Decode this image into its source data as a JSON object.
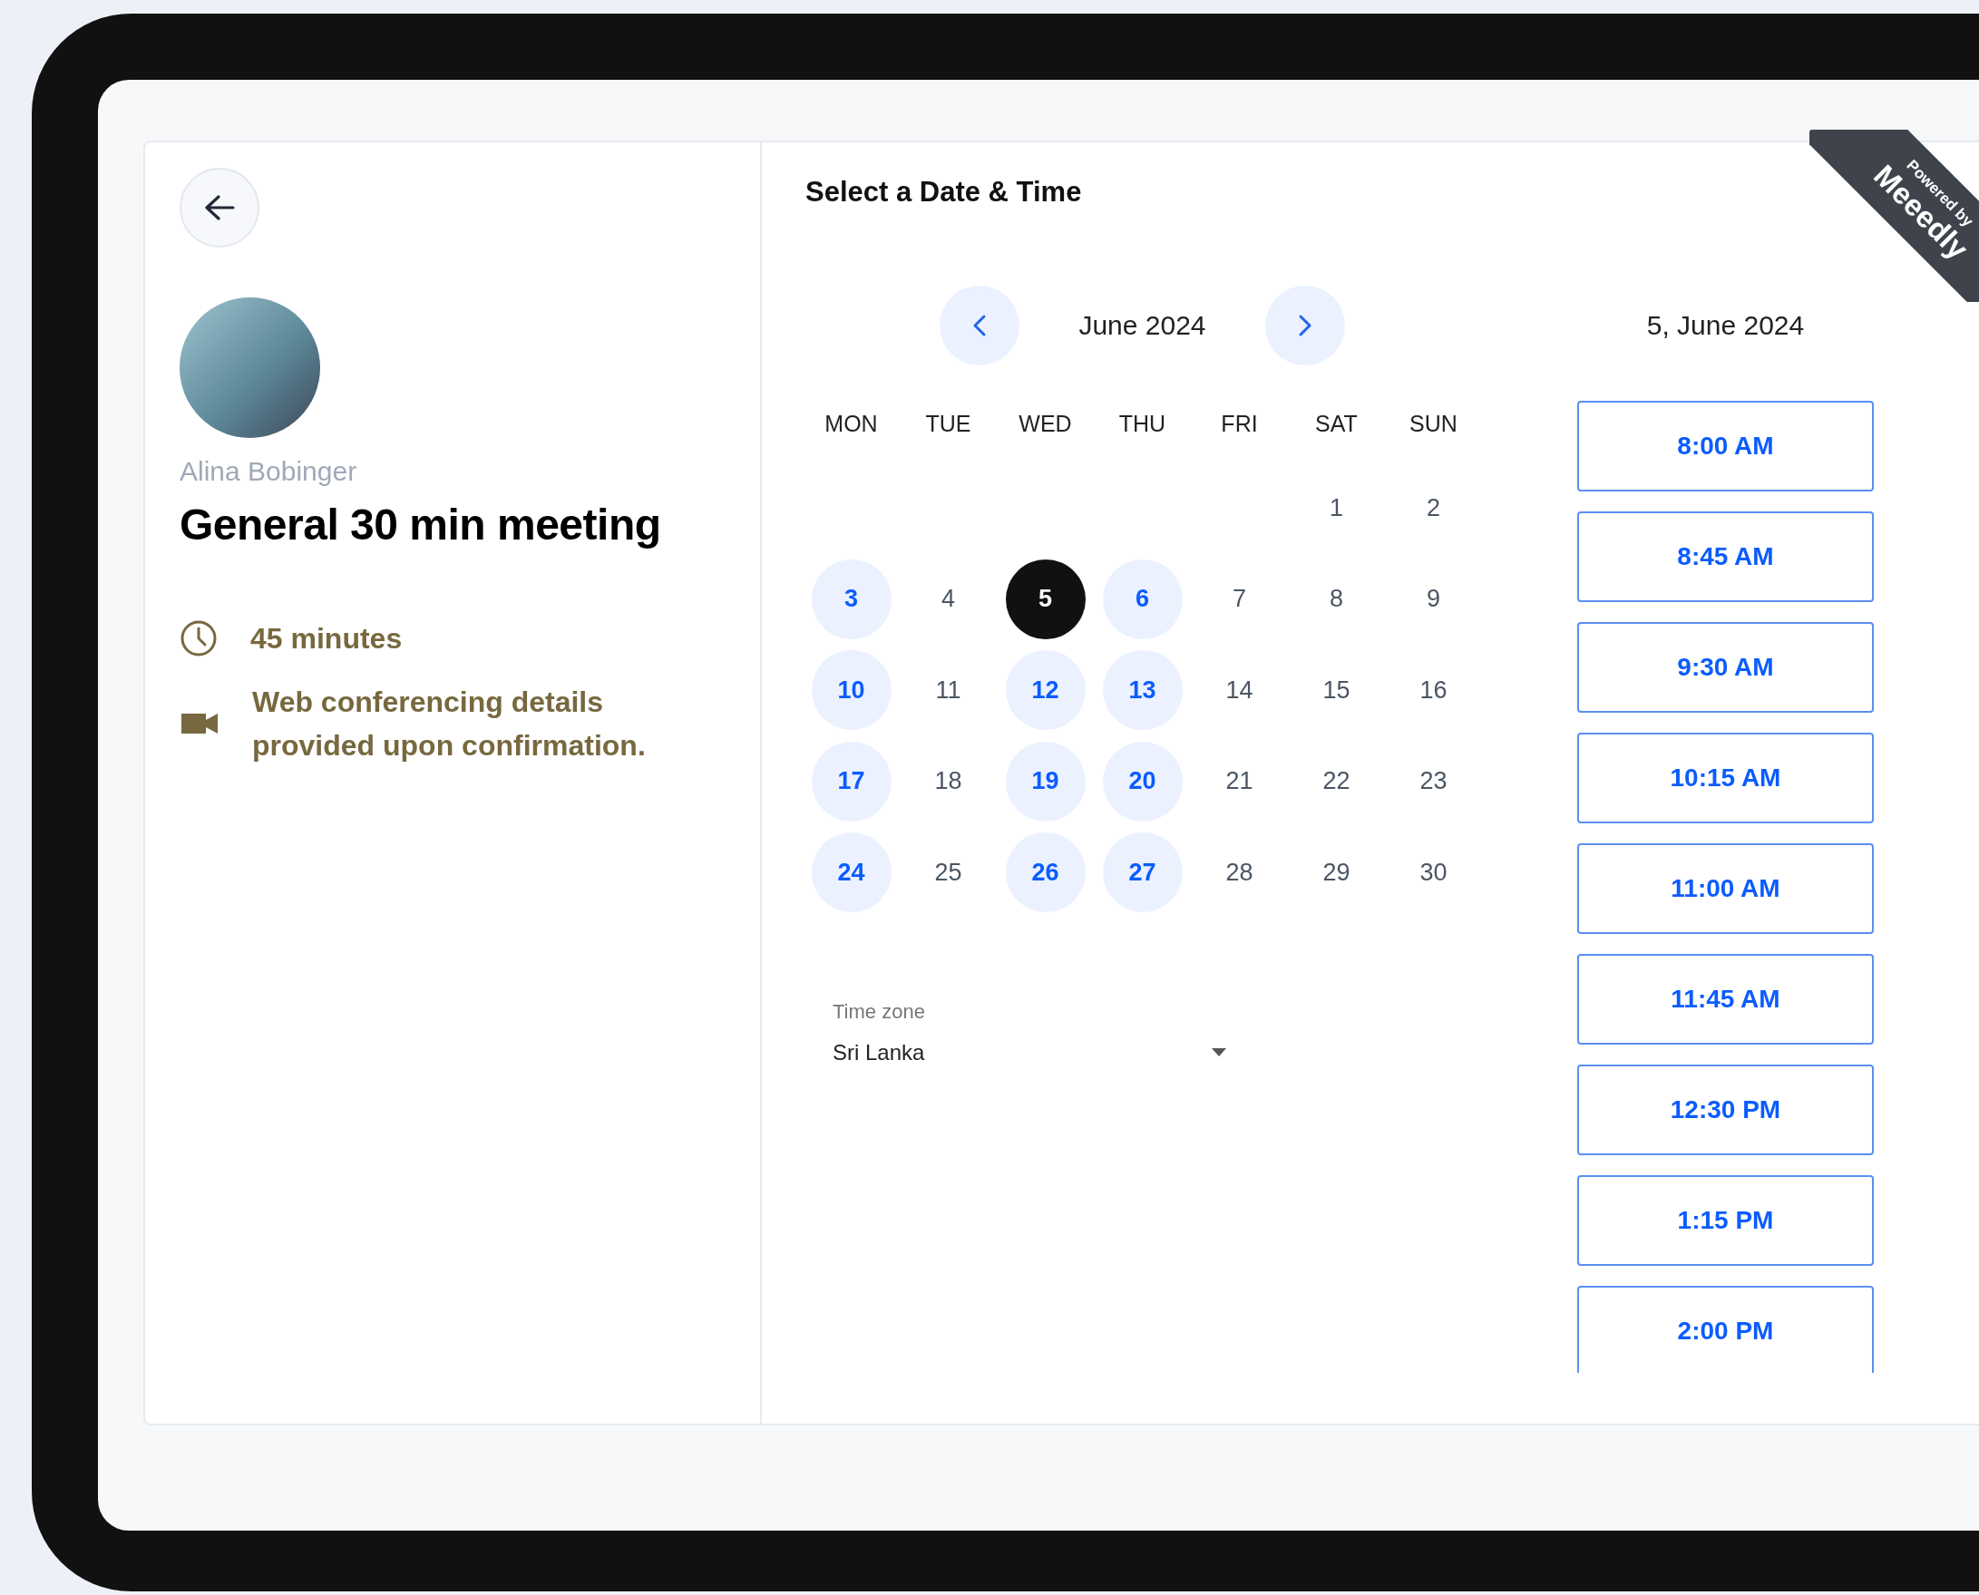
{
  "host": {
    "name": "Alina Bobinger",
    "title": "General 30 min meeting",
    "details": [
      {
        "kind": "duration",
        "text": "45 minutes"
      },
      {
        "kind": "video",
        "text": "Web conferencing details provided upon confirmation."
      }
    ]
  },
  "picker": {
    "title": "Select a Date & Time",
    "month": "June 2024",
    "weekdays": [
      "MON",
      "TUE",
      "WED",
      "THU",
      "FRI",
      "SAT",
      "SUN"
    ],
    "weeks": [
      [
        {
          "kind": "blank"
        },
        {
          "kind": "blank"
        },
        {
          "kind": "blank"
        },
        {
          "kind": "blank"
        },
        {
          "kind": "blank"
        },
        {
          "kind": "day",
          "label": "1",
          "available": false,
          "selected": false
        },
        {
          "kind": "day",
          "label": "2",
          "available": false,
          "selected": false
        }
      ],
      [
        {
          "kind": "day",
          "label": "3",
          "available": true,
          "selected": false
        },
        {
          "kind": "day",
          "label": "4",
          "available": false,
          "selected": false
        },
        {
          "kind": "day",
          "label": "5",
          "available": true,
          "selected": true
        },
        {
          "kind": "day",
          "label": "6",
          "available": true,
          "selected": false
        },
        {
          "kind": "day",
          "label": "7",
          "available": false,
          "selected": false
        },
        {
          "kind": "day",
          "label": "8",
          "available": false,
          "selected": false
        },
        {
          "kind": "day",
          "label": "9",
          "available": false,
          "selected": false
        }
      ],
      [
        {
          "kind": "day",
          "label": "10",
          "available": true,
          "selected": false
        },
        {
          "kind": "day",
          "label": "11",
          "available": false,
          "selected": false
        },
        {
          "kind": "day",
          "label": "12",
          "available": true,
          "selected": false
        },
        {
          "kind": "day",
          "label": "13",
          "available": true,
          "selected": false
        },
        {
          "kind": "day",
          "label": "14",
          "available": false,
          "selected": false
        },
        {
          "kind": "day",
          "label": "15",
          "available": false,
          "selected": false
        },
        {
          "kind": "day",
          "label": "16",
          "available": false,
          "selected": false
        }
      ],
      [
        {
          "kind": "day",
          "label": "17",
          "available": true,
          "selected": false
        },
        {
          "kind": "day",
          "label": "18",
          "available": false,
          "selected": false
        },
        {
          "kind": "day",
          "label": "19",
          "available": true,
          "selected": false
        },
        {
          "kind": "day",
          "label": "20",
          "available": true,
          "selected": false
        },
        {
          "kind": "day",
          "label": "21",
          "available": false,
          "selected": false
        },
        {
          "kind": "day",
          "label": "22",
          "available": false,
          "selected": false
        },
        {
          "kind": "day",
          "label": "23",
          "available": false,
          "selected": false
        }
      ],
      [
        {
          "kind": "day",
          "label": "24",
          "available": true,
          "selected": false
        },
        {
          "kind": "day",
          "label": "25",
          "available": false,
          "selected": false
        },
        {
          "kind": "day",
          "label": "26",
          "available": true,
          "selected": false
        },
        {
          "kind": "day",
          "label": "27",
          "available": true,
          "selected": false
        },
        {
          "kind": "day",
          "label": "28",
          "available": false,
          "selected": false
        },
        {
          "kind": "day",
          "label": "29",
          "available": false,
          "selected": false
        },
        {
          "kind": "day",
          "label": "30",
          "available": false,
          "selected": false
        }
      ]
    ],
    "time_zone": {
      "label": "Time zone",
      "value": "Sri Lanka"
    },
    "selected_date": "5, June 2024",
    "slots": [
      "8:00 AM",
      "8:45 AM",
      "9:30 AM",
      "10:15 AM",
      "11:00 AM",
      "11:45 AM",
      "12:30 PM",
      "1:15 PM",
      "2:00 PM"
    ]
  },
  "ribbon": {
    "small": "Powered by",
    "brand": "Meeedly"
  }
}
